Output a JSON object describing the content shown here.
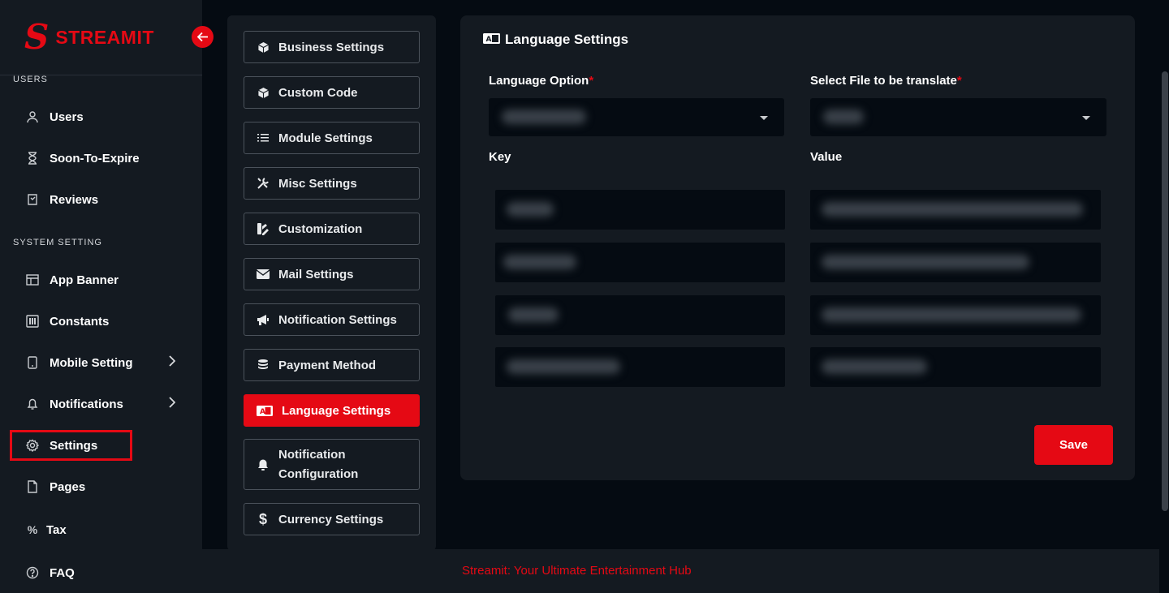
{
  "brand": {
    "logo_letter": "S",
    "name": "STREAMIT",
    "accent": "#e50914"
  },
  "sidebar": {
    "sections": [
      {
        "title": "USERS"
      },
      {
        "title": "SYSTEM SETTING"
      }
    ],
    "items": [
      {
        "label": "Users",
        "icon": "user-icon"
      },
      {
        "label": "Soon-To-Expire",
        "icon": "hourglass-icon"
      },
      {
        "label": "Reviews",
        "icon": "review-icon"
      },
      {
        "label": "App Banner",
        "icon": "banner-icon"
      },
      {
        "label": "Constants",
        "icon": "constants-icon"
      },
      {
        "label": "Mobile Setting",
        "icon": "mobile-icon",
        "has_submenu": true
      },
      {
        "label": "Notifications",
        "icon": "bell-icon",
        "has_submenu": true
      },
      {
        "label": "Settings",
        "icon": "gear-icon",
        "selected": true
      },
      {
        "label": "Pages",
        "icon": "page-icon"
      },
      {
        "label": "Tax",
        "icon": "percent-icon"
      },
      {
        "label": "FAQ",
        "icon": "question-icon"
      }
    ]
  },
  "settings_menu": {
    "items": [
      {
        "label": "Business Settings",
        "icon": "cube-icon"
      },
      {
        "label": "Custom Code",
        "icon": "cube-icon"
      },
      {
        "label": "Module Settings",
        "icon": "list-icon"
      },
      {
        "label": "Misc Settings",
        "icon": "tools-icon"
      },
      {
        "label": "Customization",
        "icon": "palette-icon"
      },
      {
        "label": "Mail Settings",
        "icon": "envelope-icon"
      },
      {
        "label": "Notification Settings",
        "icon": "megaphone-icon"
      },
      {
        "label": "Payment Method",
        "icon": "coins-icon"
      },
      {
        "label": "Language Settings",
        "icon": "language-icon",
        "active": true
      },
      {
        "label": "Notification Configuration",
        "icon": "bell-icon"
      },
      {
        "label": "Currency Settings",
        "icon": "dollar-icon"
      }
    ]
  },
  "language_settings": {
    "title": "Language Settings",
    "language_option_label": "Language Option",
    "file_label": "Select File to be translate",
    "required_marker": "*",
    "key_header": "Key",
    "value_header": "Value",
    "save_label": "Save"
  },
  "footer": {
    "text": "Streamit: Your Ultimate Entertainment Hub"
  }
}
